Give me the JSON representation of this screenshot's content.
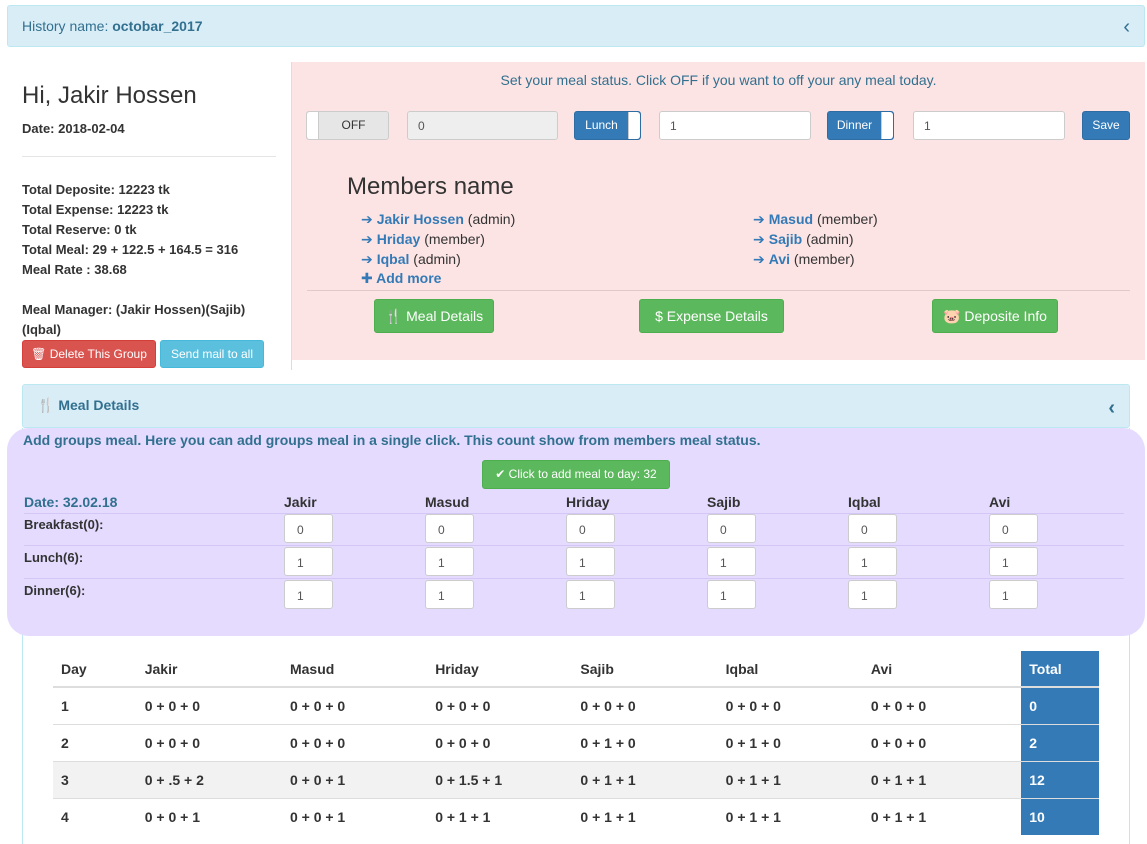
{
  "history": {
    "label": "History name:",
    "name": "octobar_2017"
  },
  "user": {
    "greeting": "Hi, Jakir Hossen",
    "date": "Date: 2018-02-04",
    "stats": [
      "Total Deposite: 12223 tk",
      "Total Expense: 12223 tk",
      "Total Reserve: 0 tk",
      "Total Meal: 29 + 122.5 + 164.5 = 316",
      "Meal Rate : 38.68"
    ],
    "manager": "Meal Manager: (Jakir Hossen)(Sajib)(Iqbal)",
    "delete_label": "Delete This Group",
    "mail_label": "Send mail to all"
  },
  "meal_status": {
    "note": "Set your meal status. Click OFF if you want to off your any meal today.",
    "off_label": "OFF",
    "off_value": "0",
    "lunch_label": "Lunch",
    "lunch_value": "1",
    "dinner_label": "Dinner",
    "dinner_value": "1",
    "save_label": "Save"
  },
  "members": {
    "title": "Members name",
    "list": [
      {
        "name": "Jakir Hossen",
        "role": "(admin)"
      },
      {
        "name": "Masud",
        "role": "(member)"
      },
      {
        "name": "Hriday",
        "role": "(member)"
      },
      {
        "name": "Sajib",
        "role": "(admin)"
      },
      {
        "name": "Iqbal",
        "role": "(admin)"
      },
      {
        "name": "Avi",
        "role": "(member)"
      }
    ],
    "add_more": "Add more"
  },
  "actions": {
    "meal_details": "Meal Details",
    "expense_details": "Expense Details",
    "deposite_info": "Deposite Info"
  },
  "meal_details_panel": {
    "title": "Meal Details"
  },
  "group_meal": {
    "note": "Add groups meal. Here you can add groups meal in a single click. This count show from members meal status.",
    "button": "Click to add meal to day: 32",
    "date": "Date: 32.02.18",
    "columns": [
      "Jakir",
      "Masud",
      "Hriday",
      "Sajib",
      "Iqbal",
      "Avi"
    ],
    "rows": [
      {
        "label": "Breakfast(0):",
        "values": [
          "0",
          "0",
          "0",
          "0",
          "0",
          "0"
        ]
      },
      {
        "label": "Lunch(6):",
        "values": [
          "1",
          "1",
          "1",
          "1",
          "1",
          "1"
        ]
      },
      {
        "label": "Dinner(6):",
        "values": [
          "1",
          "1",
          "1",
          "1",
          "1",
          "1"
        ]
      }
    ]
  },
  "meal_table": {
    "headers": [
      "Day",
      "Jakir",
      "Masud",
      "Hriday",
      "Sajib",
      "Iqbal",
      "Avi",
      "Total"
    ],
    "rows": [
      [
        "1",
        "0 + 0 + 0",
        "0 + 0 + 0",
        "0 + 0 + 0",
        "0 + 0 + 0",
        "0 + 0 + 0",
        "0 + 0 + 0",
        "0"
      ],
      [
        "2",
        "0 + 0 + 0",
        "0 + 0 + 0",
        "0 + 0 + 0",
        "0 + 1 + 0",
        "0 + 1 + 0",
        "0 + 0 + 0",
        "2"
      ],
      [
        "3",
        "0 + .5 + 2",
        "0 + 0 + 1",
        "0 + 1.5 + 1",
        "0 + 1 + 1",
        "0 + 1 + 1",
        "0 + 1 + 1",
        "12"
      ],
      [
        "4",
        "0 + 0 + 1",
        "0 + 0 + 1",
        "0 + 1 + 1",
        "0 + 1 + 1",
        "0 + 1 + 1",
        "0 + 1 + 1",
        "10"
      ]
    ]
  },
  "colors": {
    "primary": "#337ab7",
    "success": "#5cb85c",
    "danger": "#d9534f",
    "info": "#5bc0de",
    "pink_panel": "#fde4e4",
    "purple_panel": "#e5dbff",
    "info_panel": "#d9edf7"
  }
}
